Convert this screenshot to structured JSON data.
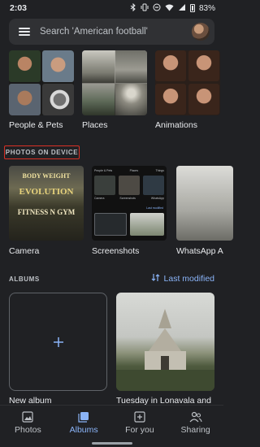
{
  "status_bar": {
    "time": "2:03",
    "battery": "83%"
  },
  "search": {
    "placeholder": "Search 'American football'"
  },
  "categories": [
    {
      "label": "People & Pets"
    },
    {
      "label": "Places"
    },
    {
      "label": "Animations"
    }
  ],
  "device_section": {
    "title": "PHOTOS ON DEVICE",
    "folders": [
      {
        "label": "Camera"
      },
      {
        "label": "Screenshots"
      },
      {
        "label": "WhatsApp A"
      }
    ],
    "camera_sign": [
      "BODY WEIGHT",
      "EVOLUTION",
      "FITNESS N GYM"
    ],
    "screenshot_thumb": {
      "tabs": [
        "People & Pets",
        "Places",
        "Things"
      ],
      "mini_labels": [
        "Camera",
        "Screenshots",
        "WhatsApp"
      ],
      "sort": "Last modified"
    }
  },
  "albums": {
    "title": "ALBUMS",
    "sort_label": "Last modified",
    "new_album_label": "New album",
    "items": [
      {
        "label": "Tuesday in Lonavala and"
      }
    ]
  },
  "bottom_nav": [
    {
      "label": "Photos",
      "icon": "photo-icon",
      "active": false
    },
    {
      "label": "Albums",
      "icon": "albums-icon",
      "active": true
    },
    {
      "label": "For you",
      "icon": "for-you-icon",
      "active": false
    },
    {
      "label": "Sharing",
      "icon": "sharing-icon",
      "active": false
    }
  ],
  "colors": {
    "background": "#202124",
    "accent": "#8ab4f8",
    "highlight_box": "#d93025"
  }
}
